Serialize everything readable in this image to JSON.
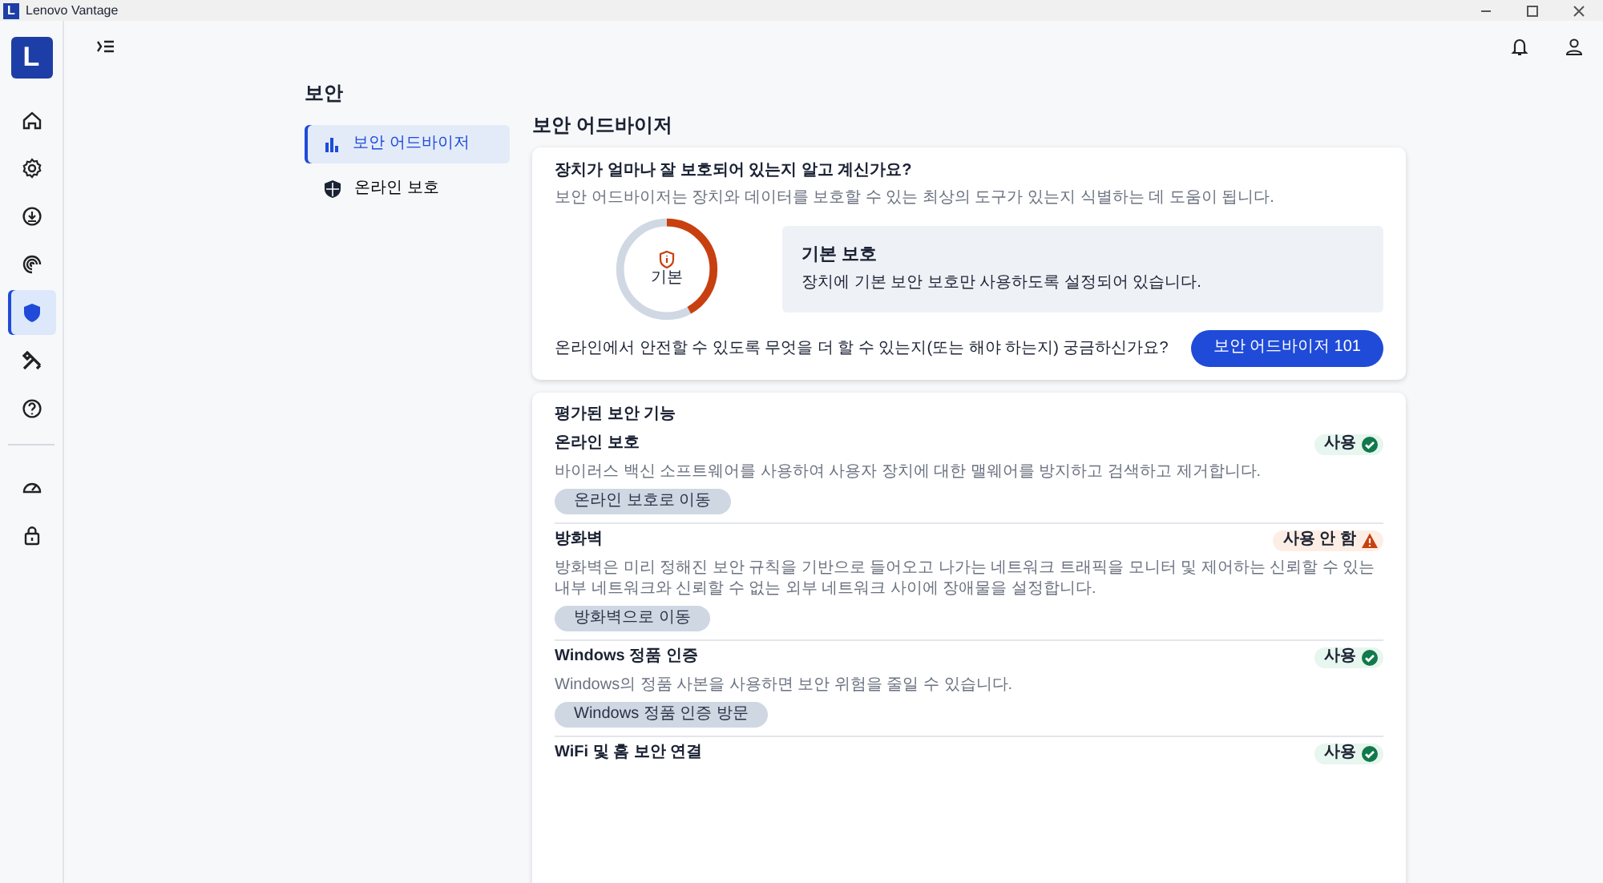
{
  "window": {
    "title": "Lenovo Vantage"
  },
  "title_icon": "L",
  "app_logo": "L",
  "rail": [
    {
      "kind": "home",
      "selected": false
    },
    {
      "kind": "gear",
      "selected": false
    },
    {
      "kind": "download",
      "selected": false
    },
    {
      "kind": "spiral",
      "selected": false
    },
    {
      "kind": "shield",
      "selected": true
    },
    {
      "kind": "tools",
      "selected": false
    },
    {
      "kind": "help",
      "selected": false
    }
  ],
  "rail_bottom": [
    {
      "kind": "gauge",
      "selected": false
    },
    {
      "kind": "lock",
      "selected": false
    }
  ],
  "section_title": "보안",
  "subnav": [
    {
      "label": "보안 어드바이저",
      "kind": "chart",
      "selected": true
    },
    {
      "label": "온라인 보호",
      "kind": "shield",
      "selected": false
    }
  ],
  "page_title": "보안 어드바이저",
  "overview": {
    "question": "장치가 얼마나 잘 보호되어 있는지 알고 계신가요?",
    "description": "보안 어드바이저는 장치와 데이터를 보호할 수 있는 최상의 도구가 있는지 식별하는 데 도움이 됩니다.",
    "gauge": {
      "label": "기본",
      "level": 0.42
    },
    "status": {
      "title": "기본 보호",
      "text": "장치에 기본 보안 보호만 사용하도록 설정되어 있습니다."
    },
    "prompt": "온라인에서 안전할 수 있도록 무엇을 더 할 수 있는지(또는 해야 하는지) 궁금하신가요?",
    "button": "보안 어드바이저 101"
  },
  "features": {
    "title": "평가된 보안 기능",
    "items": [
      {
        "name": "온라인 보호",
        "status": "사용",
        "enabled": true,
        "description": "바이러스 백신 소프트웨어를 사용하여 사용자 장치에 대한 맬웨어를 방지하고 검색하고 제거합니다.",
        "button": "온라인 보호로 이동"
      },
      {
        "name": "방화벽",
        "status": "사용 안 함",
        "enabled": false,
        "description": "방화벽은 미리 정해진 보안 규칙을 기반으로 들어오고 나가는 네트워크 트래픽을 모니터 및 제어하는 신뢰할 수 있는 내부 네트워크와 신뢰할 수 없는 외부 네트워크 사이에 장애물을 설정합니다.",
        "button": "방화벽으로 이동"
      },
      {
        "name": "Windows 정품 인증",
        "status": "사용",
        "enabled": true,
        "description": "Windows의 정품 사본을 사용하면 보안 위험을 줄일 수 있습니다.",
        "button": "Windows 정품 인증 방문"
      },
      {
        "name": "WiFi 및 홈 보안 연결",
        "status": "사용",
        "enabled": true
      }
    ]
  }
}
